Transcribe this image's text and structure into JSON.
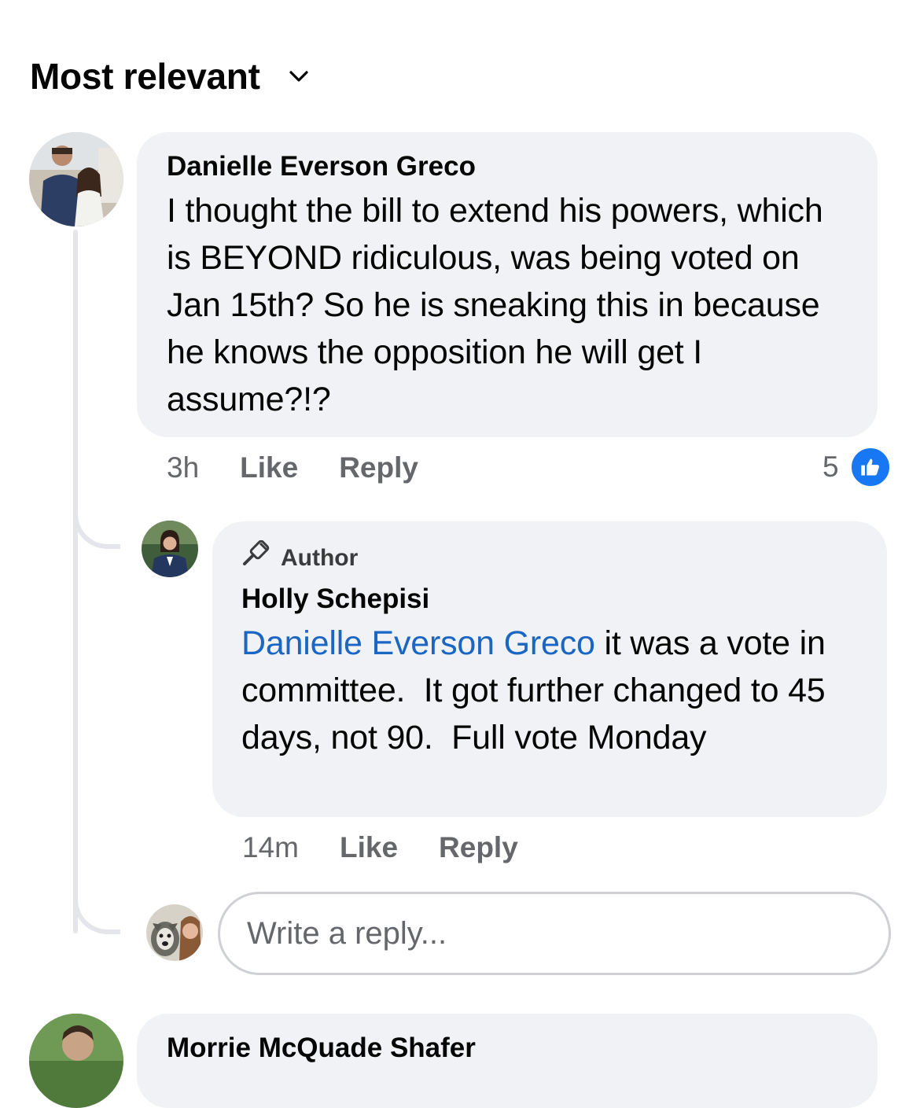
{
  "sort": {
    "label": "Most relevant",
    "chevron_icon": "chevron-down-icon"
  },
  "comments": [
    {
      "author": "Danielle Everson Greco",
      "text": "I thought the bill to extend his powers, which is BEYOND ridiculous, was being voted on Jan 15th? So he is sneaking this in because he knows the opposition he will get I assume?!?",
      "time": "3h",
      "like_label": "Like",
      "reply_label": "Reply",
      "reaction_count": "5",
      "reaction_icon": "thumbs-up-icon"
    }
  ],
  "reply": {
    "badge": "Author",
    "badge_icon": "microphone-icon",
    "author": "Holly Schepisi",
    "mention": "Danielle Everson Greco",
    "text": " it was a vote in committee.  It got further changed to 45 days, not 90.  Full vote Monday",
    "time": "14m",
    "like_label": "Like",
    "reply_label": "Reply"
  },
  "composer": {
    "placeholder": "Write a reply..."
  },
  "next_comment": {
    "author": "Morrie McQuade Shafer"
  },
  "colors": {
    "bubble": "#f0f2f5",
    "mention": "#1a66c2",
    "muted": "#65676b",
    "like_blue": "#1877f2"
  }
}
